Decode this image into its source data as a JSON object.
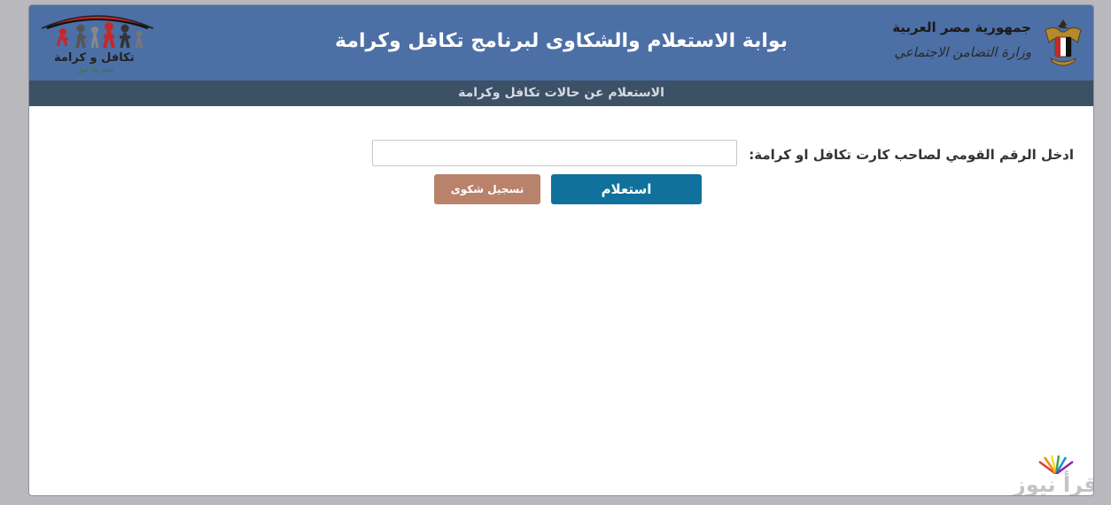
{
  "header": {
    "title": "بوابة الاستعلام والشكاوى لبرنامج تكافل وكرامة",
    "republic": "جمهورية مصر العربية",
    "ministry": "وزارة التضامن الاجتماعي",
    "emblem_icon": "egypt-eagle-emblem-icon",
    "logo_icon": "takaful-karama-logo-icon",
    "logo_name": "تكافل و كرامة",
    "logo_tagline": "مصر بلا عوز",
    "background_color": "#4c6fa6"
  },
  "subheader": {
    "text": "الاستعلام عن حالات تكافل وكرامة",
    "background_color": "#3c5066"
  },
  "form": {
    "id_label": "ادخل الرقم القومي لصاحب كارت تكافل او كرامة:",
    "id_value": "",
    "inquiry_label": "استعلام",
    "inquiry_color": "#10729c",
    "complaint_label": "تسجيل شكوى",
    "complaint_color": "#b8836a"
  },
  "watermark": {
    "text": "إقرأ نيوز",
    "icon": "book-fan-icon"
  }
}
